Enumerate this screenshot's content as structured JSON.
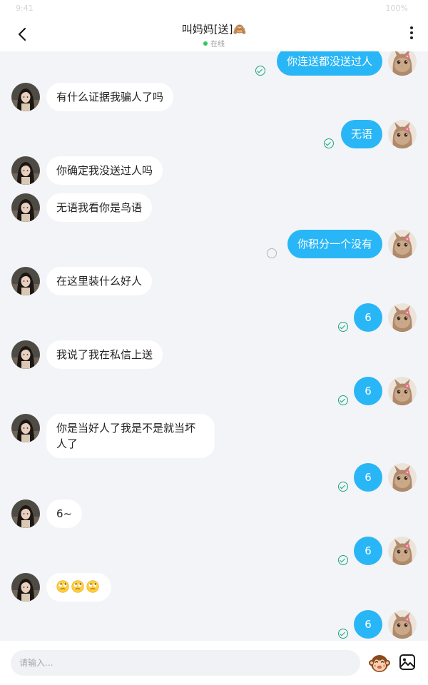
{
  "statusbar": {
    "left": "9:41",
    "right": "100%"
  },
  "header": {
    "title": "叫妈妈[送]🙈",
    "status": "在线",
    "back_icon": "chevron-left-icon",
    "more_icon": "more-vertical-icon",
    "online_color": "#34c759"
  },
  "messages": [
    {
      "side": "out",
      "text": "你连送都没送过人",
      "state": "read"
    },
    {
      "side": "in",
      "text": "有什么证据我骗人了吗"
    },
    {
      "side": "out",
      "text": "无语",
      "state": "read"
    },
    {
      "side": "in",
      "text": "你确定我没送过人吗"
    },
    {
      "side": "in",
      "text": "无语我看你是鸟语"
    },
    {
      "side": "out",
      "text": "你积分一个没有",
      "state": "pending"
    },
    {
      "side": "in",
      "text": "在这里装什么好人"
    },
    {
      "side": "out",
      "text": "6",
      "state": "read"
    },
    {
      "side": "in",
      "text": "我说了我在私信上送"
    },
    {
      "side": "out",
      "text": "6",
      "state": "read"
    },
    {
      "side": "in",
      "text": "你是当好人了我是不是就当坏人了"
    },
    {
      "side": "out",
      "text": "6",
      "state": "read"
    },
    {
      "side": "in",
      "text": "6~"
    },
    {
      "side": "out",
      "text": "6",
      "state": "read"
    },
    {
      "side": "in",
      "emoji": [
        "eye-roll-emoji",
        "eye-roll-emoji",
        "eye-roll-emoji"
      ]
    },
    {
      "side": "out",
      "text": "6",
      "state": "read"
    }
  ],
  "composer": {
    "placeholder": "请输入...",
    "sticker_icon": "monkey-sticker-icon",
    "image_icon": "image-icon"
  },
  "colors": {
    "outgoing_bubble": "#29b6f6",
    "incoming_bubble": "#ffffff",
    "background": "#f3f4f7",
    "read_tick": "#18a878"
  }
}
